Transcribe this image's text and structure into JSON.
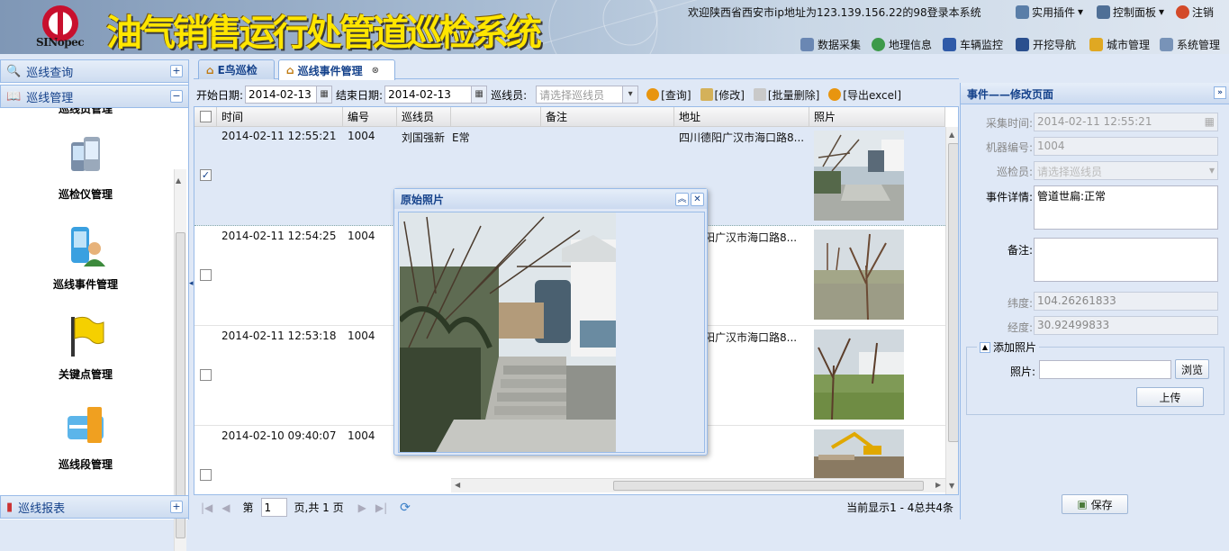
{
  "header": {
    "logo_text": "SINopec",
    "title": "油气销售运行处管道巡检系统",
    "welcome": "欢迎陕西省西安市ip地址为123.139.156.22的98登录本系统",
    "top_menu": [
      {
        "label": "实用插件",
        "icon": "plugin-icon"
      },
      {
        "label": "控制面板",
        "icon": "control-panel-icon"
      },
      {
        "label": "注销",
        "icon": "logout-icon"
      }
    ],
    "nav_links": [
      {
        "label": "数据采集",
        "icon": "data-collect-icon"
      },
      {
        "label": "地理信息",
        "icon": "globe-icon"
      },
      {
        "label": "车辆监控",
        "icon": "car-icon"
      },
      {
        "label": "开挖导航",
        "icon": "dig-nav-icon"
      },
      {
        "label": "城市管理",
        "icon": "city-icon"
      },
      {
        "label": "系统管理",
        "icon": "system-icon"
      }
    ]
  },
  "sidebar": {
    "sections": [
      {
        "label": "巡线查询",
        "toggle": "+"
      },
      {
        "label": "巡线管理",
        "toggle": "−"
      },
      {
        "label": "巡线报表",
        "toggle": "+"
      }
    ],
    "partial_label": "巡线员管理",
    "modules": [
      {
        "label": "巡检仪管理",
        "icon": "phone-device-icon"
      },
      {
        "label": "巡线事件管理",
        "icon": "user-phone-icon"
      },
      {
        "label": "关键点管理",
        "icon": "flag-icon"
      },
      {
        "label": "巡线段管理",
        "icon": "segment-icon"
      }
    ]
  },
  "tabs": [
    {
      "label": "E鸟巡检",
      "active": false
    },
    {
      "label": "巡线事件管理",
      "active": true
    }
  ],
  "toolbar": {
    "start_label": "开始日期:",
    "start_value": "2014-02-13",
    "end_label": "结束日期:",
    "end_value": "2014-02-13",
    "inspector_label": "巡线员:",
    "inspector_placeholder": "请选择巡线员",
    "buttons": [
      "[查询]",
      "[修改]",
      "[批量删除]",
      "[导出excel]"
    ]
  },
  "grid": {
    "columns": [
      "时间",
      "编号",
      "巡线员",
      "",
      "备注",
      "地址",
      "照片"
    ],
    "rows": [
      {
        "time": "2014-02-11 12:55:21",
        "id": "1004",
        "inspector": "刘国强新",
        "detail": "E常",
        "remark": "",
        "address": "四川德阳广汉市海口路8...",
        "checked": true
      },
      {
        "time": "2014-02-11 12:54:25",
        "id": "1004",
        "inspector": "",
        "detail": "",
        "remark": "",
        "address": "阳广汉市海口路8...",
        "checked": false
      },
      {
        "time": "2014-02-11 12:53:18",
        "id": "1004",
        "inspector": "",
        "detail": "",
        "remark": "",
        "address": "阳广汉市海口路8...",
        "checked": false
      },
      {
        "time": "2014-02-10 09:40:07",
        "id": "1004",
        "inspector": "",
        "detail": "",
        "remark": "",
        "address": "",
        "checked": false
      }
    ]
  },
  "pager": {
    "page_prefix": "第",
    "page_value": "1",
    "page_suffix": "页,共 1 页",
    "summary": "当前显示1 - 4总共4条"
  },
  "popup": {
    "title": "原始照片"
  },
  "right_panel": {
    "title": "事件——修改页面",
    "fields": [
      {
        "label": "采集时间:",
        "value": "2014-02-11 12:55:21",
        "enabled": false
      },
      {
        "label": "机器编号:",
        "value": "1004",
        "enabled": false
      },
      {
        "label": "巡检员:",
        "value": "请选择巡线员",
        "enabled": false
      },
      {
        "label": "事件详情:",
        "value": "管道世扁:正常",
        "enabled": true
      },
      {
        "label": "备注:",
        "value": "",
        "enabled": true
      },
      {
        "label": "纬度:",
        "value": "104.26261833",
        "enabled": false
      },
      {
        "label": "经度:",
        "value": "30.92499833",
        "enabled": false
      }
    ],
    "photo_section": "添加照片",
    "photo_label": "照片:",
    "browse": "浏览",
    "upload": "上传",
    "save": "保存"
  },
  "colors": {
    "panel_bg": "#dfe8f6",
    "border": "#99bbe8",
    "header_text": "#15428b",
    "title_yellow": "#ffe600"
  }
}
